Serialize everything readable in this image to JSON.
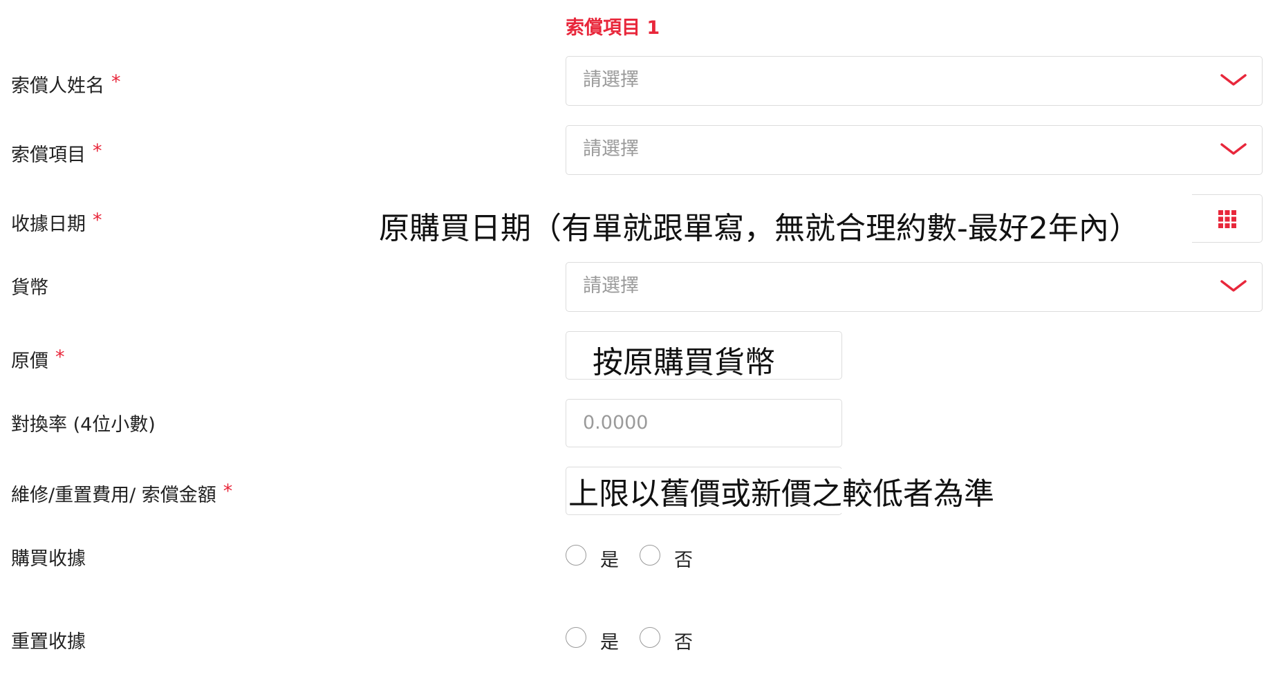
{
  "section_title": "索償項目 1",
  "required_mark": "*",
  "fields": {
    "claimant_name": {
      "label": "索償人姓名",
      "placeholder": "請選擇"
    },
    "claim_item": {
      "label": "索償項目",
      "placeholder": "請選擇"
    },
    "receipt_date": {
      "label": "收據日期",
      "note": "原購買日期（有單就跟單寫，無就合理約數-最好2年內）"
    },
    "currency": {
      "label": "貨幣",
      "placeholder": "請選擇"
    },
    "original_price": {
      "label": "原價",
      "note": "按原購買貨幣"
    },
    "exchange_rate": {
      "label": "對換率 (4位小數)",
      "placeholder": "0.0000"
    },
    "claim_amount": {
      "label": "維修/重置費用/ 索償金額",
      "note": "上限以舊價或新價之較低者為準"
    },
    "purchase_receipt": {
      "label": "購買收據",
      "options": [
        "是",
        "否"
      ]
    },
    "replacement_receipt": {
      "label": "重置收據",
      "options": [
        "是",
        "否"
      ]
    }
  },
  "icons": {
    "dropdown": "chevron-down-icon",
    "calendar": "calendar-grid-icon"
  },
  "colors": {
    "accent": "#e8273b",
    "border": "#dcdcdc",
    "placeholder": "#9a9a9a"
  }
}
